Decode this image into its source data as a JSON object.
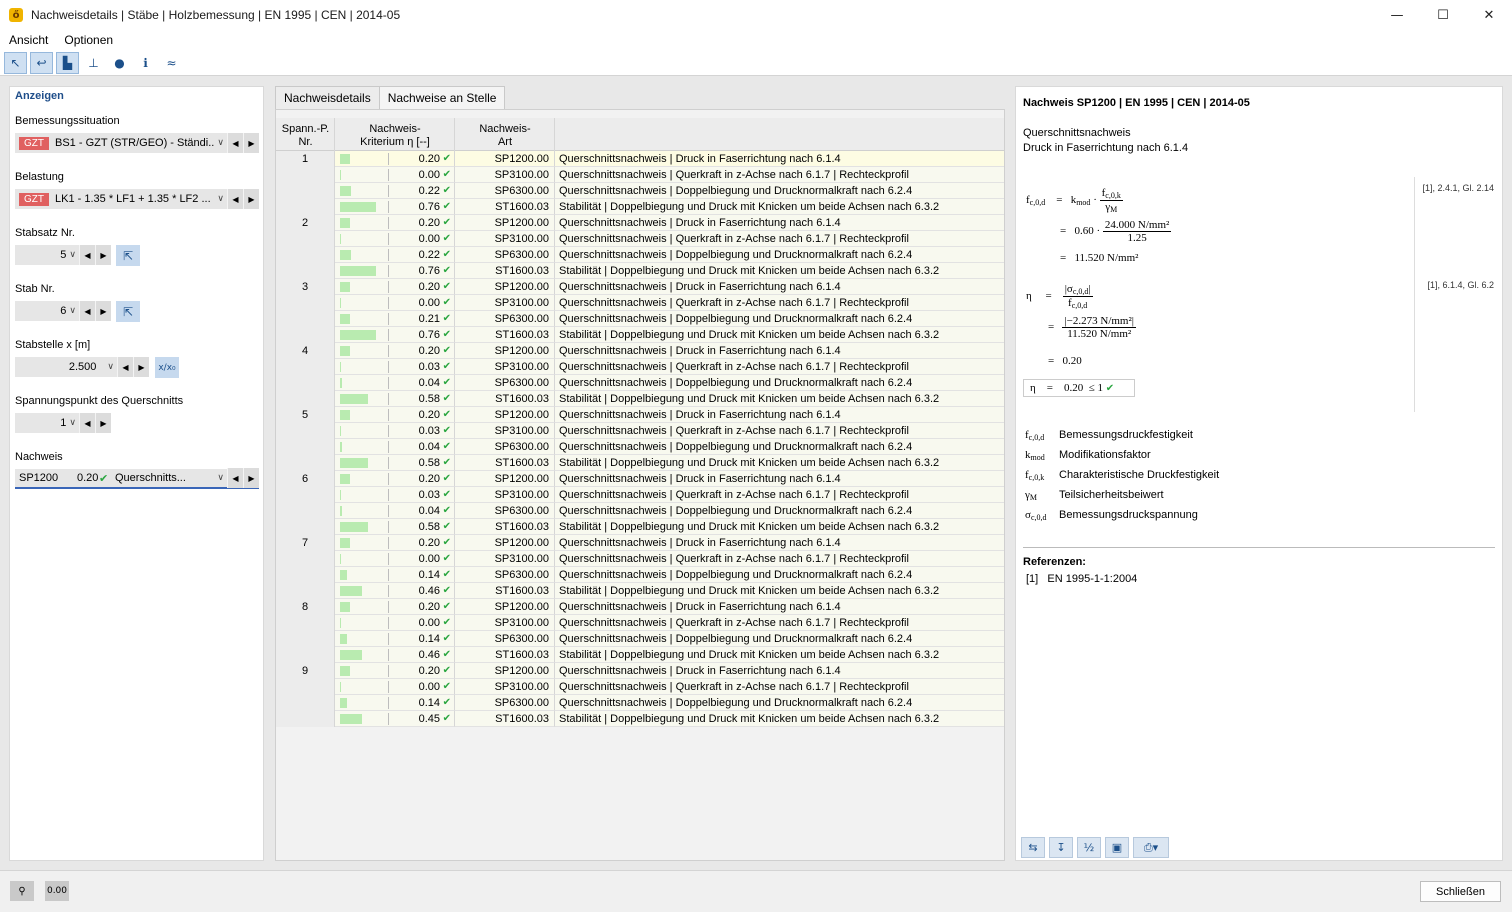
{
  "window": {
    "title": "Nachweisdetails | Stäbe | Holzbemessung | EN 1995 | CEN | 2014-05",
    "minimize": "—",
    "maximize": "☐",
    "close": "✕"
  },
  "menu": [
    "Ansicht",
    "Optionen"
  ],
  "left": {
    "header": "Anzeigen",
    "situation_label": "Bemessungssituation",
    "situation_badge": "GZT",
    "situation_value": "BS1 - GZT (STR/GEO) - Ständi...",
    "loading_label": "Belastung",
    "loading_badge": "GZT",
    "loading_value": "LK1 - 1.35 * LF1 + 1.35 * LF2 ...",
    "memberset_label": "Stabsatz Nr.",
    "memberset_value": "5",
    "member_label": "Stab Nr.",
    "member_value": "6",
    "location_label": "Stabstelle x [m]",
    "location_value": "2.500",
    "location_btn": "x/x₀",
    "stresspoint_label": "Spannungspunkt des Querschnitts",
    "stresspoint_value": "1",
    "check_label": "Nachweis",
    "check_id": "SP1200",
    "check_ratio": "0.20",
    "check_type": "Querschnitts..."
  },
  "tabs": [
    "Nachweisdetails",
    "Nachweise an Stelle"
  ],
  "table": {
    "headers": {
      "col1": "Spann.-P.\nNr.",
      "col2": "Nachweis-\nKriterium η [--]",
      "col3": "Nachweis-\nArt"
    },
    "rows": [
      {
        "p": "1",
        "eta": "0.20",
        "id": "SP1200.00",
        "desc": "Querschnittsnachweis | Druck in Faserrichtung nach 6.1.4",
        "fill": 0.2
      },
      {
        "p": "",
        "eta": "0.00",
        "id": "SP3100.00",
        "desc": "Querschnittsnachweis | Querkraft in z-Achse nach 6.1.7 | Rechteckprofil",
        "fill": 0.0
      },
      {
        "p": "",
        "eta": "0.22",
        "id": "SP6300.00",
        "desc": "Querschnittsnachweis | Doppelbiegung und Drucknormalkraft nach 6.2.4",
        "fill": 0.22
      },
      {
        "p": "",
        "eta": "0.76",
        "id": "ST1600.03",
        "desc": "Stabilität | Doppelbiegung und Druck mit Knicken um beide Achsen nach 6.3.2",
        "fill": 0.76
      },
      {
        "p": "2",
        "eta": "0.20",
        "id": "SP1200.00",
        "desc": "Querschnittsnachweis | Druck in Faserrichtung nach 6.1.4",
        "fill": 0.2
      },
      {
        "p": "",
        "eta": "0.00",
        "id": "SP3100.00",
        "desc": "Querschnittsnachweis | Querkraft in z-Achse nach 6.1.7 | Rechteckprofil",
        "fill": 0.0
      },
      {
        "p": "",
        "eta": "0.22",
        "id": "SP6300.00",
        "desc": "Querschnittsnachweis | Doppelbiegung und Drucknormalkraft nach 6.2.4",
        "fill": 0.22
      },
      {
        "p": "",
        "eta": "0.76",
        "id": "ST1600.03",
        "desc": "Stabilität | Doppelbiegung und Druck mit Knicken um beide Achsen nach 6.3.2",
        "fill": 0.76
      },
      {
        "p": "3",
        "eta": "0.20",
        "id": "SP1200.00",
        "desc": "Querschnittsnachweis | Druck in Faserrichtung nach 6.1.4",
        "fill": 0.2
      },
      {
        "p": "",
        "eta": "0.00",
        "id": "SP3100.00",
        "desc": "Querschnittsnachweis | Querkraft in z-Achse nach 6.1.7 | Rechteckprofil",
        "fill": 0.0
      },
      {
        "p": "",
        "eta": "0.21",
        "id": "SP6300.00",
        "desc": "Querschnittsnachweis | Doppelbiegung und Drucknormalkraft nach 6.2.4",
        "fill": 0.21
      },
      {
        "p": "",
        "eta": "0.76",
        "id": "ST1600.03",
        "desc": "Stabilität | Doppelbiegung und Druck mit Knicken um beide Achsen nach 6.3.2",
        "fill": 0.76
      },
      {
        "p": "4",
        "eta": "0.20",
        "id": "SP1200.00",
        "desc": "Querschnittsnachweis | Druck in Faserrichtung nach 6.1.4",
        "fill": 0.2
      },
      {
        "p": "",
        "eta": "0.03",
        "id": "SP3100.00",
        "desc": "Querschnittsnachweis | Querkraft in z-Achse nach 6.1.7 | Rechteckprofil",
        "fill": 0.03
      },
      {
        "p": "",
        "eta": "0.04",
        "id": "SP6300.00",
        "desc": "Querschnittsnachweis | Doppelbiegung und Drucknormalkraft nach 6.2.4",
        "fill": 0.04
      },
      {
        "p": "",
        "eta": "0.58",
        "id": "ST1600.03",
        "desc": "Stabilität | Doppelbiegung und Druck mit Knicken um beide Achsen nach 6.3.2",
        "fill": 0.58
      },
      {
        "p": "5",
        "eta": "0.20",
        "id": "SP1200.00",
        "desc": "Querschnittsnachweis | Druck in Faserrichtung nach 6.1.4",
        "fill": 0.2
      },
      {
        "p": "",
        "eta": "0.03",
        "id": "SP3100.00",
        "desc": "Querschnittsnachweis | Querkraft in z-Achse nach 6.1.7 | Rechteckprofil",
        "fill": 0.03
      },
      {
        "p": "",
        "eta": "0.04",
        "id": "SP6300.00",
        "desc": "Querschnittsnachweis | Doppelbiegung und Drucknormalkraft nach 6.2.4",
        "fill": 0.04
      },
      {
        "p": "",
        "eta": "0.58",
        "id": "ST1600.03",
        "desc": "Stabilität | Doppelbiegung und Druck mit Knicken um beide Achsen nach 6.3.2",
        "fill": 0.58
      },
      {
        "p": "6",
        "eta": "0.20",
        "id": "SP1200.00",
        "desc": "Querschnittsnachweis | Druck in Faserrichtung nach 6.1.4",
        "fill": 0.2
      },
      {
        "p": "",
        "eta": "0.03",
        "id": "SP3100.00",
        "desc": "Querschnittsnachweis | Querkraft in z-Achse nach 6.1.7 | Rechteckprofil",
        "fill": 0.03
      },
      {
        "p": "",
        "eta": "0.04",
        "id": "SP6300.00",
        "desc": "Querschnittsnachweis | Doppelbiegung und Drucknormalkraft nach 6.2.4",
        "fill": 0.04
      },
      {
        "p": "",
        "eta": "0.58",
        "id": "ST1600.03",
        "desc": "Stabilität | Doppelbiegung und Druck mit Knicken um beide Achsen nach 6.3.2",
        "fill": 0.58
      },
      {
        "p": "7",
        "eta": "0.20",
        "id": "SP1200.00",
        "desc": "Querschnittsnachweis | Druck in Faserrichtung nach 6.1.4",
        "fill": 0.2
      },
      {
        "p": "",
        "eta": "0.00",
        "id": "SP3100.00",
        "desc": "Querschnittsnachweis | Querkraft in z-Achse nach 6.1.7 | Rechteckprofil",
        "fill": 0.0
      },
      {
        "p": "",
        "eta": "0.14",
        "id": "SP6300.00",
        "desc": "Querschnittsnachweis | Doppelbiegung und Drucknormalkraft nach 6.2.4",
        "fill": 0.14
      },
      {
        "p": "",
        "eta": "0.46",
        "id": "ST1600.03",
        "desc": "Stabilität | Doppelbiegung und Druck mit Knicken um beide Achsen nach 6.3.2",
        "fill": 0.46
      },
      {
        "p": "8",
        "eta": "0.20",
        "id": "SP1200.00",
        "desc": "Querschnittsnachweis | Druck in Faserrichtung nach 6.1.4",
        "fill": 0.2
      },
      {
        "p": "",
        "eta": "0.00",
        "id": "SP3100.00",
        "desc": "Querschnittsnachweis | Querkraft in z-Achse nach 6.1.7 | Rechteckprofil",
        "fill": 0.0
      },
      {
        "p": "",
        "eta": "0.14",
        "id": "SP6300.00",
        "desc": "Querschnittsnachweis | Doppelbiegung und Drucknormalkraft nach 6.2.4",
        "fill": 0.14
      },
      {
        "p": "",
        "eta": "0.46",
        "id": "ST1600.03",
        "desc": "Stabilität | Doppelbiegung und Druck mit Knicken um beide Achsen nach 6.3.2",
        "fill": 0.46
      },
      {
        "p": "9",
        "eta": "0.20",
        "id": "SP1200.00",
        "desc": "Querschnittsnachweis | Druck in Faserrichtung nach 6.1.4",
        "fill": 0.2
      },
      {
        "p": "",
        "eta": "0.00",
        "id": "SP3100.00",
        "desc": "Querschnittsnachweis | Querkraft in z-Achse nach 6.1.7 | Rechteckprofil",
        "fill": 0.0
      },
      {
        "p": "",
        "eta": "0.14",
        "id": "SP6300.00",
        "desc": "Querschnittsnachweis | Doppelbiegung und Drucknormalkraft nach 6.2.4",
        "fill": 0.14
      },
      {
        "p": "",
        "eta": "0.45",
        "id": "ST1600.03",
        "desc": "Stabilität | Doppelbiegung und Druck mit Knicken um beide Achsen nach 6.3.2",
        "fill": 0.45
      }
    ]
  },
  "right": {
    "title": "Nachweis SP1200 | EN 1995 | CEN | 2014-05",
    "subtitle1": "Querschnittsnachweis",
    "subtitle2": "Druck in Faserrichtung nach 6.1.4",
    "ref1": "[1], 2.4.1, Gl. 2.14",
    "ref2": "[1], 6.1.4, Gl. 6.2",
    "kmod_val": "0.60",
    "fck_val": "24.000 N/mm²",
    "gamma_val": "1.25",
    "fcd_val": "11.520 N/mm²",
    "sigma_val": "−2.273 N/mm²",
    "fcd_den": "11.520 N/mm²",
    "eta_val": "0.20",
    "eta_box": "0.20",
    "eta_limit": "1",
    "legend": [
      {
        "sym": "fc,0,d",
        "text": "Bemessungsdruckfestigkeit"
      },
      {
        "sym": "kmod",
        "text": "Modifikationsfaktor"
      },
      {
        "sym": "fc,0,k",
        "text": "Charakteristische Druckfestigkeit"
      },
      {
        "sym": "γM",
        "text": "Teilsicherheitsbeiwert"
      },
      {
        "sym": "σc,0,d",
        "text": "Bemessungsdruckspannung"
      }
    ],
    "refs_title": "Referenzen:",
    "ref_entry_no": "[1]",
    "ref_entry": "EN 1995-1-1:2004"
  },
  "footer": {
    "close": "Schließen",
    "units": "0.00"
  }
}
